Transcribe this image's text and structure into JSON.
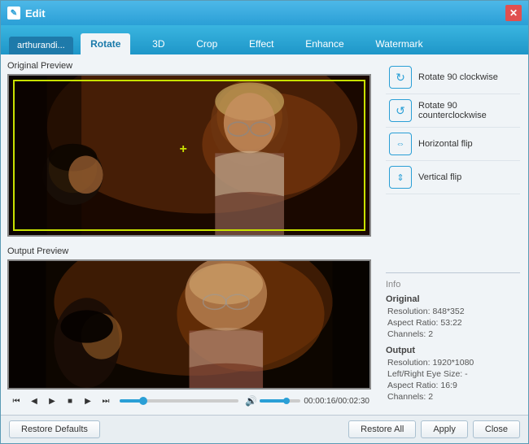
{
  "window": {
    "title": "Edit",
    "close_label": "✕"
  },
  "file_tab": {
    "label": "arthurandi..."
  },
  "tabs": [
    {
      "label": "Rotate",
      "id": "rotate",
      "active": true
    },
    {
      "label": "3D",
      "id": "3d",
      "active": false
    },
    {
      "label": "Crop",
      "id": "crop",
      "active": false
    },
    {
      "label": "Effect",
      "id": "effect",
      "active": false
    },
    {
      "label": "Enhance",
      "id": "enhance",
      "active": false
    },
    {
      "label": "Watermark",
      "id": "watermark",
      "active": false
    }
  ],
  "original_preview_label": "Original Preview",
  "output_preview_label": "Output Preview",
  "rotate_buttons": [
    {
      "label": "Rotate 90 clockwise",
      "icon": "↻",
      "name": "rotate-cw"
    },
    {
      "label": "Rotate 90 counterclockwise",
      "icon": "↺",
      "name": "rotate-ccw"
    },
    {
      "label": "Horizontal flip",
      "icon": "⇔",
      "name": "h-flip"
    },
    {
      "label": "Vertical flip",
      "icon": "⇕",
      "name": "v-flip"
    }
  ],
  "info": {
    "section_label": "Info",
    "original_label": "Original",
    "original_resolution": "Resolution: 848*352",
    "original_aspect": "Aspect Ratio: 53:22",
    "original_channels": "Channels: 2",
    "output_label": "Output",
    "output_resolution": "Resolution: 1920*1080",
    "output_lr_size": "Left/Right Eye Size: -",
    "output_aspect": "Aspect Ratio: 16:9",
    "output_channels": "Channels: 2"
  },
  "playback": {
    "time": "00:00:16/00:02:30"
  },
  "transport": {
    "skip_back": "⏮",
    "prev": "⏭",
    "play": "▶",
    "stop": "⏹",
    "next": "⏭",
    "skip_fwd": "⏭"
  },
  "bottom_buttons": {
    "restore_defaults": "Restore Defaults",
    "restore_all": "Restore All",
    "apply": "Apply",
    "close": "Close"
  }
}
